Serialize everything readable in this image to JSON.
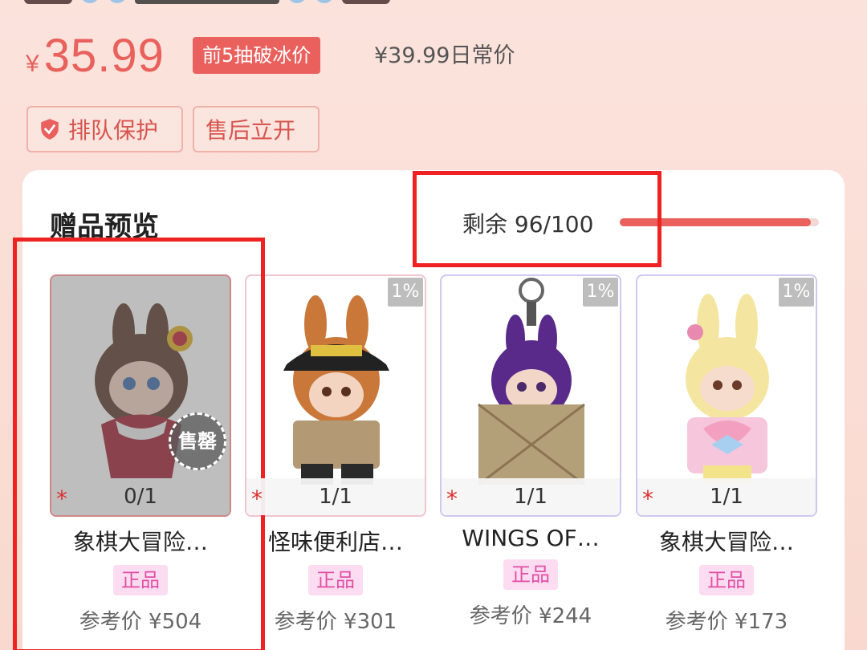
{
  "product": {
    "currency_symbol": "¥",
    "price": "35.99",
    "promo_badge": "前5抽破冰价",
    "regular_price": "¥39.99日常价",
    "tags": [
      "排队保护",
      "售后立开"
    ]
  },
  "gift_section": {
    "title": "赠品预览",
    "remaining_label": "剩余 96/100",
    "remaining_fraction": 0.96,
    "items": [
      {
        "name": "象棋大冒险…",
        "stock": "0/1",
        "probability": "",
        "badge": "正品",
        "ref_price": "参考价 ¥504",
        "sold_out": true,
        "sold_label": "售罄"
      },
      {
        "name": "怪味便利店…",
        "stock": "1/1",
        "probability": "1%",
        "badge": "正品",
        "ref_price": "参考价 ¥301",
        "sold_out": false
      },
      {
        "name": "WINGS OF…",
        "stock": "1/1",
        "probability": "1%",
        "badge": "正品",
        "ref_price": "参考价 ¥244",
        "sold_out": false
      },
      {
        "name": "象棋大冒险…",
        "stock": "1/1",
        "probability": "1%",
        "badge": "正品",
        "ref_price": "参考价 ¥173",
        "sold_out": false
      }
    ]
  },
  "colors": {
    "accent": "#e9605c",
    "highlight_box": "#ee2222",
    "genuine_bg": "#fbdcf0",
    "genuine_text": "#e24fa6"
  }
}
